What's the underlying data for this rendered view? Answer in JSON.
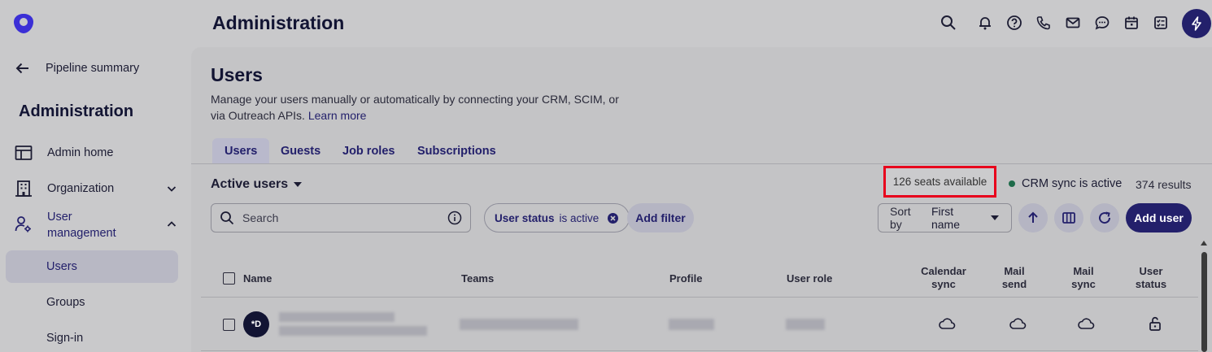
{
  "header": {
    "title": "Administration",
    "icons": [
      "search-icon",
      "bell-icon",
      "help-icon",
      "phone-icon",
      "mail-icon",
      "chat-icon",
      "calendar-icon",
      "tasks-icon",
      "bolt-icon"
    ]
  },
  "sidebar": {
    "back_label": "Pipeline summary",
    "heading": "Administration",
    "items": [
      {
        "label": "Admin home",
        "icon": "table-icon"
      },
      {
        "label": "Organization",
        "icon": "building-icon"
      },
      {
        "label": "User management",
        "icon": "user-gear-icon"
      },
      {
        "label": "Users"
      },
      {
        "label": "Groups"
      },
      {
        "label": "Sign-in"
      }
    ]
  },
  "main": {
    "title": "Users",
    "description_line1": "Manage your users manually or automatically by connecting your CRM, SCIM, or",
    "description_line2": "via Outreach APIs.",
    "learn_more": "Learn more",
    "tabs": [
      "Users",
      "Guests",
      "Job roles",
      "Subscriptions"
    ],
    "view_label": "Active users",
    "seats": "126 seats available",
    "crm_status": "CRM sync is active",
    "results": "374 results",
    "search_placeholder": "Search",
    "filter_chip_field": "User status",
    "filter_chip_value": "is active",
    "add_filter": "Add filter",
    "sort_prefix": "Sort by",
    "sort_value": "First name",
    "add_user": "Add user"
  },
  "table": {
    "columns": [
      "Name",
      "Teams",
      "Profile",
      "User role",
      "Calendar sync",
      "Mail send",
      "Mail sync",
      "User status"
    ],
    "col_calendar_1": "Calendar",
    "col_calendar_2": "sync",
    "col_mailsend_1": "Mail",
    "col_mailsend_2": "send",
    "col_mailsync_1": "Mail",
    "col_mailsync_2": "sync",
    "col_status_1": "User",
    "col_status_2": "status",
    "rows": [
      {
        "avatar_initials": "*D"
      }
    ]
  },
  "colors": {
    "brand": "#23206b",
    "highlight_border": "#e8001c",
    "crm_dot": "#1e6b4a"
  }
}
